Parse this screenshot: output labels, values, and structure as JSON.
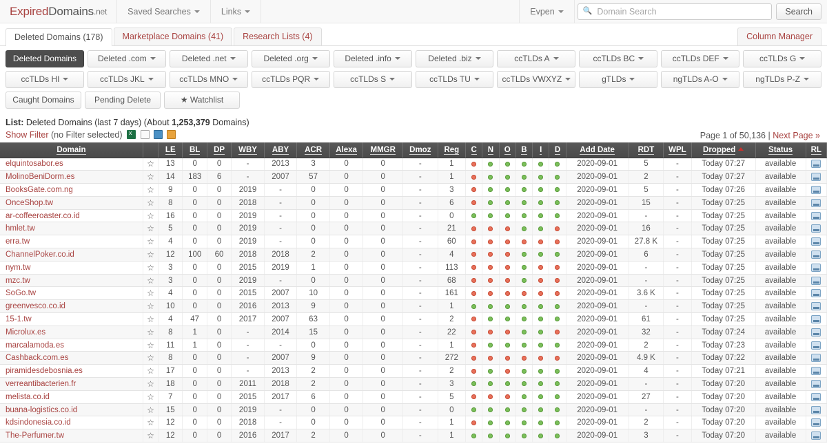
{
  "navbar": {
    "brand": {
      "part1": "Expired",
      "part2": "Domains",
      "part3": ".net"
    },
    "items": [
      {
        "label": "Saved Searches",
        "caret": true
      },
      {
        "label": "Links",
        "caret": true
      }
    ],
    "user": {
      "label": "Evpen",
      "caret": true
    },
    "search": {
      "placeholder": "Domain Search",
      "value": "",
      "button": "Search",
      "icon": "search-icon"
    }
  },
  "tabs": [
    {
      "label": "Deleted Domains (178)",
      "active": true
    },
    {
      "label": "Marketplace Domains (41)",
      "active": false
    },
    {
      "label": "Research Lists (4)",
      "active": false
    }
  ],
  "column_manager": "Column Manager",
  "filter_buttons": {
    "row1": [
      {
        "label": "Deleted Domains",
        "caret": false,
        "active": true
      },
      {
        "label": "Deleted .com",
        "caret": true,
        "active": false
      },
      {
        "label": "Deleted .net",
        "caret": true,
        "active": false
      },
      {
        "label": "Deleted .org",
        "caret": true,
        "active": false
      },
      {
        "label": "Deleted .info",
        "caret": true,
        "active": false
      },
      {
        "label": "Deleted .biz",
        "caret": true,
        "active": false
      },
      {
        "label": "ccTLDs A",
        "caret": true,
        "active": false
      },
      {
        "label": "ccTLDs BC",
        "caret": true,
        "active": false
      },
      {
        "label": "ccTLDs DEF",
        "caret": true,
        "active": false
      },
      {
        "label": "ccTLDs G",
        "caret": true,
        "active": false
      }
    ],
    "row2": [
      {
        "label": "ccTLDs HI",
        "caret": true,
        "active": false
      },
      {
        "label": "ccTLDs JKL",
        "caret": true,
        "active": false
      },
      {
        "label": "ccTLDs MNO",
        "caret": true,
        "active": false
      },
      {
        "label": "ccTLDs PQR",
        "caret": true,
        "active": false
      },
      {
        "label": "ccTLDs S",
        "caret": true,
        "active": false
      },
      {
        "label": "ccTLDs TU",
        "caret": true,
        "active": false
      },
      {
        "label": "ccTLDs VWXYZ",
        "caret": true,
        "active": false
      },
      {
        "label": "gTLDs",
        "caret": true,
        "active": false
      },
      {
        "label": "ngTLDs A-O",
        "caret": true,
        "active": false
      },
      {
        "label": "ngTLDs P-Z",
        "caret": true,
        "active": false
      }
    ],
    "row3": [
      {
        "label": "Caught Domains",
        "caret": false,
        "active": false
      },
      {
        "label": "Pending Delete",
        "caret": false,
        "active": false
      },
      {
        "label": "★ Watchlist",
        "caret": false,
        "active": false
      }
    ]
  },
  "list_info": {
    "prefix": "List:",
    "text_before_count": "Deleted Domains (last 7 days) (About",
    "count": "1,253,379",
    "text_after_count": "Domains)"
  },
  "filter_line": {
    "show_filter": "Show Filter",
    "no_filter": "(no Filter selected)",
    "icons": [
      "excel-export-icon",
      "text-export-icon",
      "save-icon",
      "clipboard-icon"
    ]
  },
  "pager": {
    "page_text": "Page 1 of 50,136",
    "separator": "|",
    "next": "Next Page »"
  },
  "table": {
    "columns": [
      {
        "key": "domain",
        "label": "Domain",
        "sortable": true
      },
      {
        "key": "star",
        "label": "",
        "sortable": false
      },
      {
        "key": "le",
        "label": "LE",
        "sortable": true
      },
      {
        "key": "bl",
        "label": "BL",
        "sortable": true
      },
      {
        "key": "dp",
        "label": "DP",
        "sortable": true
      },
      {
        "key": "wby",
        "label": "WBY",
        "sortable": true
      },
      {
        "key": "aby",
        "label": "ABY",
        "sortable": true
      },
      {
        "key": "acr",
        "label": "ACR",
        "sortable": true
      },
      {
        "key": "alexa",
        "label": "Alexa",
        "sortable": true
      },
      {
        "key": "mmgr",
        "label": "MMGR",
        "sortable": true
      },
      {
        "key": "dmoz",
        "label": "Dmoz",
        "sortable": true
      },
      {
        "key": "reg",
        "label": "Reg",
        "sortable": true
      },
      {
        "key": "c",
        "label": "C",
        "sortable": true
      },
      {
        "key": "n",
        "label": "N",
        "sortable": true
      },
      {
        "key": "o",
        "label": "O",
        "sortable": true
      },
      {
        "key": "b",
        "label": "B",
        "sortable": true
      },
      {
        "key": "i",
        "label": "I",
        "sortable": true
      },
      {
        "key": "d",
        "label": "D",
        "sortable": true
      },
      {
        "key": "add_date",
        "label": "Add Date",
        "sortable": true
      },
      {
        "key": "rdt",
        "label": "RDT",
        "sortable": true
      },
      {
        "key": "wpl",
        "label": "WPL",
        "sortable": true
      },
      {
        "key": "dropped",
        "label": "Dropped",
        "sortable": true,
        "sorted": "asc"
      },
      {
        "key": "status",
        "label": "Status",
        "sortable": true
      },
      {
        "key": "rl",
        "label": "RL",
        "sortable": false
      }
    ],
    "rows": [
      {
        "domain": "elquintosabor.es",
        "le": "13",
        "bl": "0",
        "dp": "0",
        "wby": "-",
        "aby": "2013",
        "acr": "3",
        "alexa": "0",
        "mmgr": "0",
        "dmoz": "-",
        "reg": "1",
        "flags": [
          "r",
          "g",
          "g",
          "g",
          "g",
          "g"
        ],
        "add_date": "2020-09-01",
        "rdt": "5",
        "wpl": "-",
        "dropped": "Today 07:27",
        "status": "available"
      },
      {
        "domain": "MolinoBeniDorm.es",
        "le": "14",
        "bl": "183",
        "dp": "6",
        "wby": "-",
        "aby": "2007",
        "acr": "57",
        "alexa": "0",
        "mmgr": "0",
        "dmoz": "-",
        "reg": "1",
        "flags": [
          "r",
          "g",
          "g",
          "g",
          "g",
          "g"
        ],
        "add_date": "2020-09-01",
        "rdt": "2",
        "wpl": "-",
        "dropped": "Today 07:27",
        "status": "available"
      },
      {
        "domain": "BooksGate.com.ng",
        "le": "9",
        "bl": "0",
        "dp": "0",
        "wby": "2019",
        "aby": "-",
        "acr": "0",
        "alexa": "0",
        "mmgr": "0",
        "dmoz": "-",
        "reg": "3",
        "flags": [
          "r",
          "g",
          "g",
          "g",
          "g",
          "g"
        ],
        "add_date": "2020-09-01",
        "rdt": "5",
        "wpl": "-",
        "dropped": "Today 07:26",
        "status": "available"
      },
      {
        "domain": "OnceShop.tw",
        "le": "8",
        "bl": "0",
        "dp": "0",
        "wby": "2018",
        "aby": "-",
        "acr": "0",
        "alexa": "0",
        "mmgr": "0",
        "dmoz": "-",
        "reg": "6",
        "flags": [
          "r",
          "g",
          "g",
          "g",
          "g",
          "g"
        ],
        "add_date": "2020-09-01",
        "rdt": "15",
        "wpl": "-",
        "dropped": "Today 07:25",
        "status": "available"
      },
      {
        "domain": "ar-coffeeroaster.co.id",
        "le": "16",
        "bl": "0",
        "dp": "0",
        "wby": "2019",
        "aby": "-",
        "acr": "0",
        "alexa": "0",
        "mmgr": "0",
        "dmoz": "-",
        "reg": "0",
        "flags": [
          "g",
          "g",
          "g",
          "g",
          "g",
          "g"
        ],
        "add_date": "2020-09-01",
        "rdt": "-",
        "wpl": "-",
        "dropped": "Today 07:25",
        "status": "available"
      },
      {
        "domain": "hmlet.tw",
        "le": "5",
        "bl": "0",
        "dp": "0",
        "wby": "2019",
        "aby": "-",
        "acr": "0",
        "alexa": "0",
        "mmgr": "0",
        "dmoz": "-",
        "reg": "21",
        "flags": [
          "r",
          "r",
          "r",
          "g",
          "g",
          "r"
        ],
        "add_date": "2020-09-01",
        "rdt": "16",
        "wpl": "-",
        "dropped": "Today 07:25",
        "status": "available"
      },
      {
        "domain": "erra.tw",
        "le": "4",
        "bl": "0",
        "dp": "0",
        "wby": "2019",
        "aby": "-",
        "acr": "0",
        "alexa": "0",
        "mmgr": "0",
        "dmoz": "-",
        "reg": "60",
        "flags": [
          "r",
          "r",
          "r",
          "r",
          "r",
          "r"
        ],
        "add_date": "2020-09-01",
        "rdt": "27.8 K",
        "wpl": "-",
        "dropped": "Today 07:25",
        "status": "available"
      },
      {
        "domain": "ChannelPoker.co.id",
        "le": "12",
        "bl": "100",
        "dp": "60",
        "wby": "2018",
        "aby": "2018",
        "acr": "2",
        "alexa": "0",
        "mmgr": "0",
        "dmoz": "-",
        "reg": "4",
        "flags": [
          "r",
          "r",
          "r",
          "g",
          "g",
          "g"
        ],
        "add_date": "2020-09-01",
        "rdt": "6",
        "wpl": "-",
        "dropped": "Today 07:25",
        "status": "available"
      },
      {
        "domain": "nym.tw",
        "le": "3",
        "bl": "0",
        "dp": "0",
        "wby": "2015",
        "aby": "2019",
        "acr": "1",
        "alexa": "0",
        "mmgr": "0",
        "dmoz": "-",
        "reg": "113",
        "flags": [
          "r",
          "r",
          "r",
          "g",
          "r",
          "r"
        ],
        "add_date": "2020-09-01",
        "rdt": "-",
        "wpl": "-",
        "dropped": "Today 07:25",
        "status": "available"
      },
      {
        "domain": "mzc.tw",
        "le": "3",
        "bl": "0",
        "dp": "0",
        "wby": "2019",
        "aby": "-",
        "acr": "0",
        "alexa": "0",
        "mmgr": "0",
        "dmoz": "-",
        "reg": "68",
        "flags": [
          "r",
          "r",
          "r",
          "g",
          "r",
          "r"
        ],
        "add_date": "2020-09-01",
        "rdt": "-",
        "wpl": "-",
        "dropped": "Today 07:25",
        "status": "available"
      },
      {
        "domain": "SoGo.tw",
        "le": "4",
        "bl": "0",
        "dp": "0",
        "wby": "2015",
        "aby": "2007",
        "acr": "10",
        "alexa": "0",
        "mmgr": "0",
        "dmoz": "-",
        "reg": "161",
        "flags": [
          "r",
          "r",
          "r",
          "r",
          "r",
          "r"
        ],
        "add_date": "2020-09-01",
        "rdt": "3.6 K",
        "wpl": "-",
        "dropped": "Today 07:25",
        "status": "available"
      },
      {
        "domain": "greenvesco.co.id",
        "le": "10",
        "bl": "0",
        "dp": "0",
        "wby": "2016",
        "aby": "2013",
        "acr": "9",
        "alexa": "0",
        "mmgr": "0",
        "dmoz": "-",
        "reg": "1",
        "flags": [
          "g",
          "g",
          "g",
          "g",
          "g",
          "g"
        ],
        "add_date": "2020-09-01",
        "rdt": "-",
        "wpl": "-",
        "dropped": "Today 07:25",
        "status": "available"
      },
      {
        "domain": "15-1.tw",
        "le": "4",
        "bl": "47",
        "dp": "0",
        "wby": "2017",
        "aby": "2007",
        "acr": "63",
        "alexa": "0",
        "mmgr": "0",
        "dmoz": "-",
        "reg": "2",
        "flags": [
          "r",
          "g",
          "g",
          "g",
          "g",
          "g"
        ],
        "add_date": "2020-09-01",
        "rdt": "61",
        "wpl": "-",
        "dropped": "Today 07:25",
        "status": "available"
      },
      {
        "domain": "Microlux.es",
        "le": "8",
        "bl": "1",
        "dp": "0",
        "wby": "-",
        "aby": "2014",
        "acr": "15",
        "alexa": "0",
        "mmgr": "0",
        "dmoz": "-",
        "reg": "22",
        "flags": [
          "r",
          "r",
          "r",
          "g",
          "g",
          "r"
        ],
        "add_date": "2020-09-01",
        "rdt": "32",
        "wpl": "-",
        "dropped": "Today 07:24",
        "status": "available"
      },
      {
        "domain": "marcalamoda.es",
        "le": "11",
        "bl": "1",
        "dp": "0",
        "wby": "-",
        "aby": "-",
        "acr": "0",
        "alexa": "0",
        "mmgr": "0",
        "dmoz": "-",
        "reg": "1",
        "flags": [
          "r",
          "g",
          "g",
          "g",
          "g",
          "g"
        ],
        "add_date": "2020-09-01",
        "rdt": "2",
        "wpl": "-",
        "dropped": "Today 07:23",
        "status": "available"
      },
      {
        "domain": "Cashback.com.es",
        "le": "8",
        "bl": "0",
        "dp": "0",
        "wby": "-",
        "aby": "2007",
        "acr": "9",
        "alexa": "0",
        "mmgr": "0",
        "dmoz": "-",
        "reg": "272",
        "flags": [
          "r",
          "r",
          "r",
          "r",
          "r",
          "r"
        ],
        "add_date": "2020-09-01",
        "rdt": "4.9 K",
        "wpl": "-",
        "dropped": "Today 07:22",
        "status": "available"
      },
      {
        "domain": "piramidesdebosnia.es",
        "le": "17",
        "bl": "0",
        "dp": "0",
        "wby": "-",
        "aby": "2013",
        "acr": "2",
        "alexa": "0",
        "mmgr": "0",
        "dmoz": "-",
        "reg": "2",
        "flags": [
          "r",
          "g",
          "r",
          "g",
          "g",
          "g"
        ],
        "add_date": "2020-09-01",
        "rdt": "4",
        "wpl": "-",
        "dropped": "Today 07:21",
        "status": "available"
      },
      {
        "domain": "verreantibacterien.fr",
        "le": "18",
        "bl": "0",
        "dp": "0",
        "wby": "2011",
        "aby": "2018",
        "acr": "2",
        "alexa": "0",
        "mmgr": "0",
        "dmoz": "-",
        "reg": "3",
        "flags": [
          "g",
          "g",
          "g",
          "g",
          "g",
          "g"
        ],
        "add_date": "2020-09-01",
        "rdt": "-",
        "wpl": "-",
        "dropped": "Today 07:20",
        "status": "available"
      },
      {
        "domain": "melista.co.id",
        "le": "7",
        "bl": "0",
        "dp": "0",
        "wby": "2015",
        "aby": "2017",
        "acr": "6",
        "alexa": "0",
        "mmgr": "0",
        "dmoz": "-",
        "reg": "5",
        "flags": [
          "r",
          "r",
          "r",
          "g",
          "g",
          "g"
        ],
        "add_date": "2020-09-01",
        "rdt": "27",
        "wpl": "-",
        "dropped": "Today 07:20",
        "status": "available"
      },
      {
        "domain": "buana-logistics.co.id",
        "le": "15",
        "bl": "0",
        "dp": "0",
        "wby": "2019",
        "aby": "-",
        "acr": "0",
        "alexa": "0",
        "mmgr": "0",
        "dmoz": "-",
        "reg": "0",
        "flags": [
          "g",
          "g",
          "g",
          "g",
          "g",
          "g"
        ],
        "add_date": "2020-09-01",
        "rdt": "-",
        "wpl": "-",
        "dropped": "Today 07:20",
        "status": "available"
      },
      {
        "domain": "kdsindonesia.co.id",
        "le": "12",
        "bl": "0",
        "dp": "0",
        "wby": "2018",
        "aby": "-",
        "acr": "0",
        "alexa": "0",
        "mmgr": "0",
        "dmoz": "-",
        "reg": "1",
        "flags": [
          "r",
          "g",
          "g",
          "g",
          "g",
          "g"
        ],
        "add_date": "2020-09-01",
        "rdt": "2",
        "wpl": "-",
        "dropped": "Today 07:20",
        "status": "available"
      },
      {
        "domain": "The-Perfumer.tw",
        "le": "12",
        "bl": "0",
        "dp": "0",
        "wby": "2016",
        "aby": "2017",
        "acr": "2",
        "alexa": "0",
        "mmgr": "0",
        "dmoz": "-",
        "reg": "1",
        "flags": [
          "g",
          "g",
          "g",
          "g",
          "g",
          "g"
        ],
        "add_date": "2020-09-01",
        "rdt": "3",
        "wpl": "-",
        "dropped": "Today 07:20",
        "status": "available"
      }
    ]
  },
  "colors": {
    "brand_red": "#a94442",
    "available_green": "#3c763d",
    "flag_green": "#7bbf5a",
    "flag_red": "#e8705a",
    "header_dark": "#4a4a4a"
  }
}
